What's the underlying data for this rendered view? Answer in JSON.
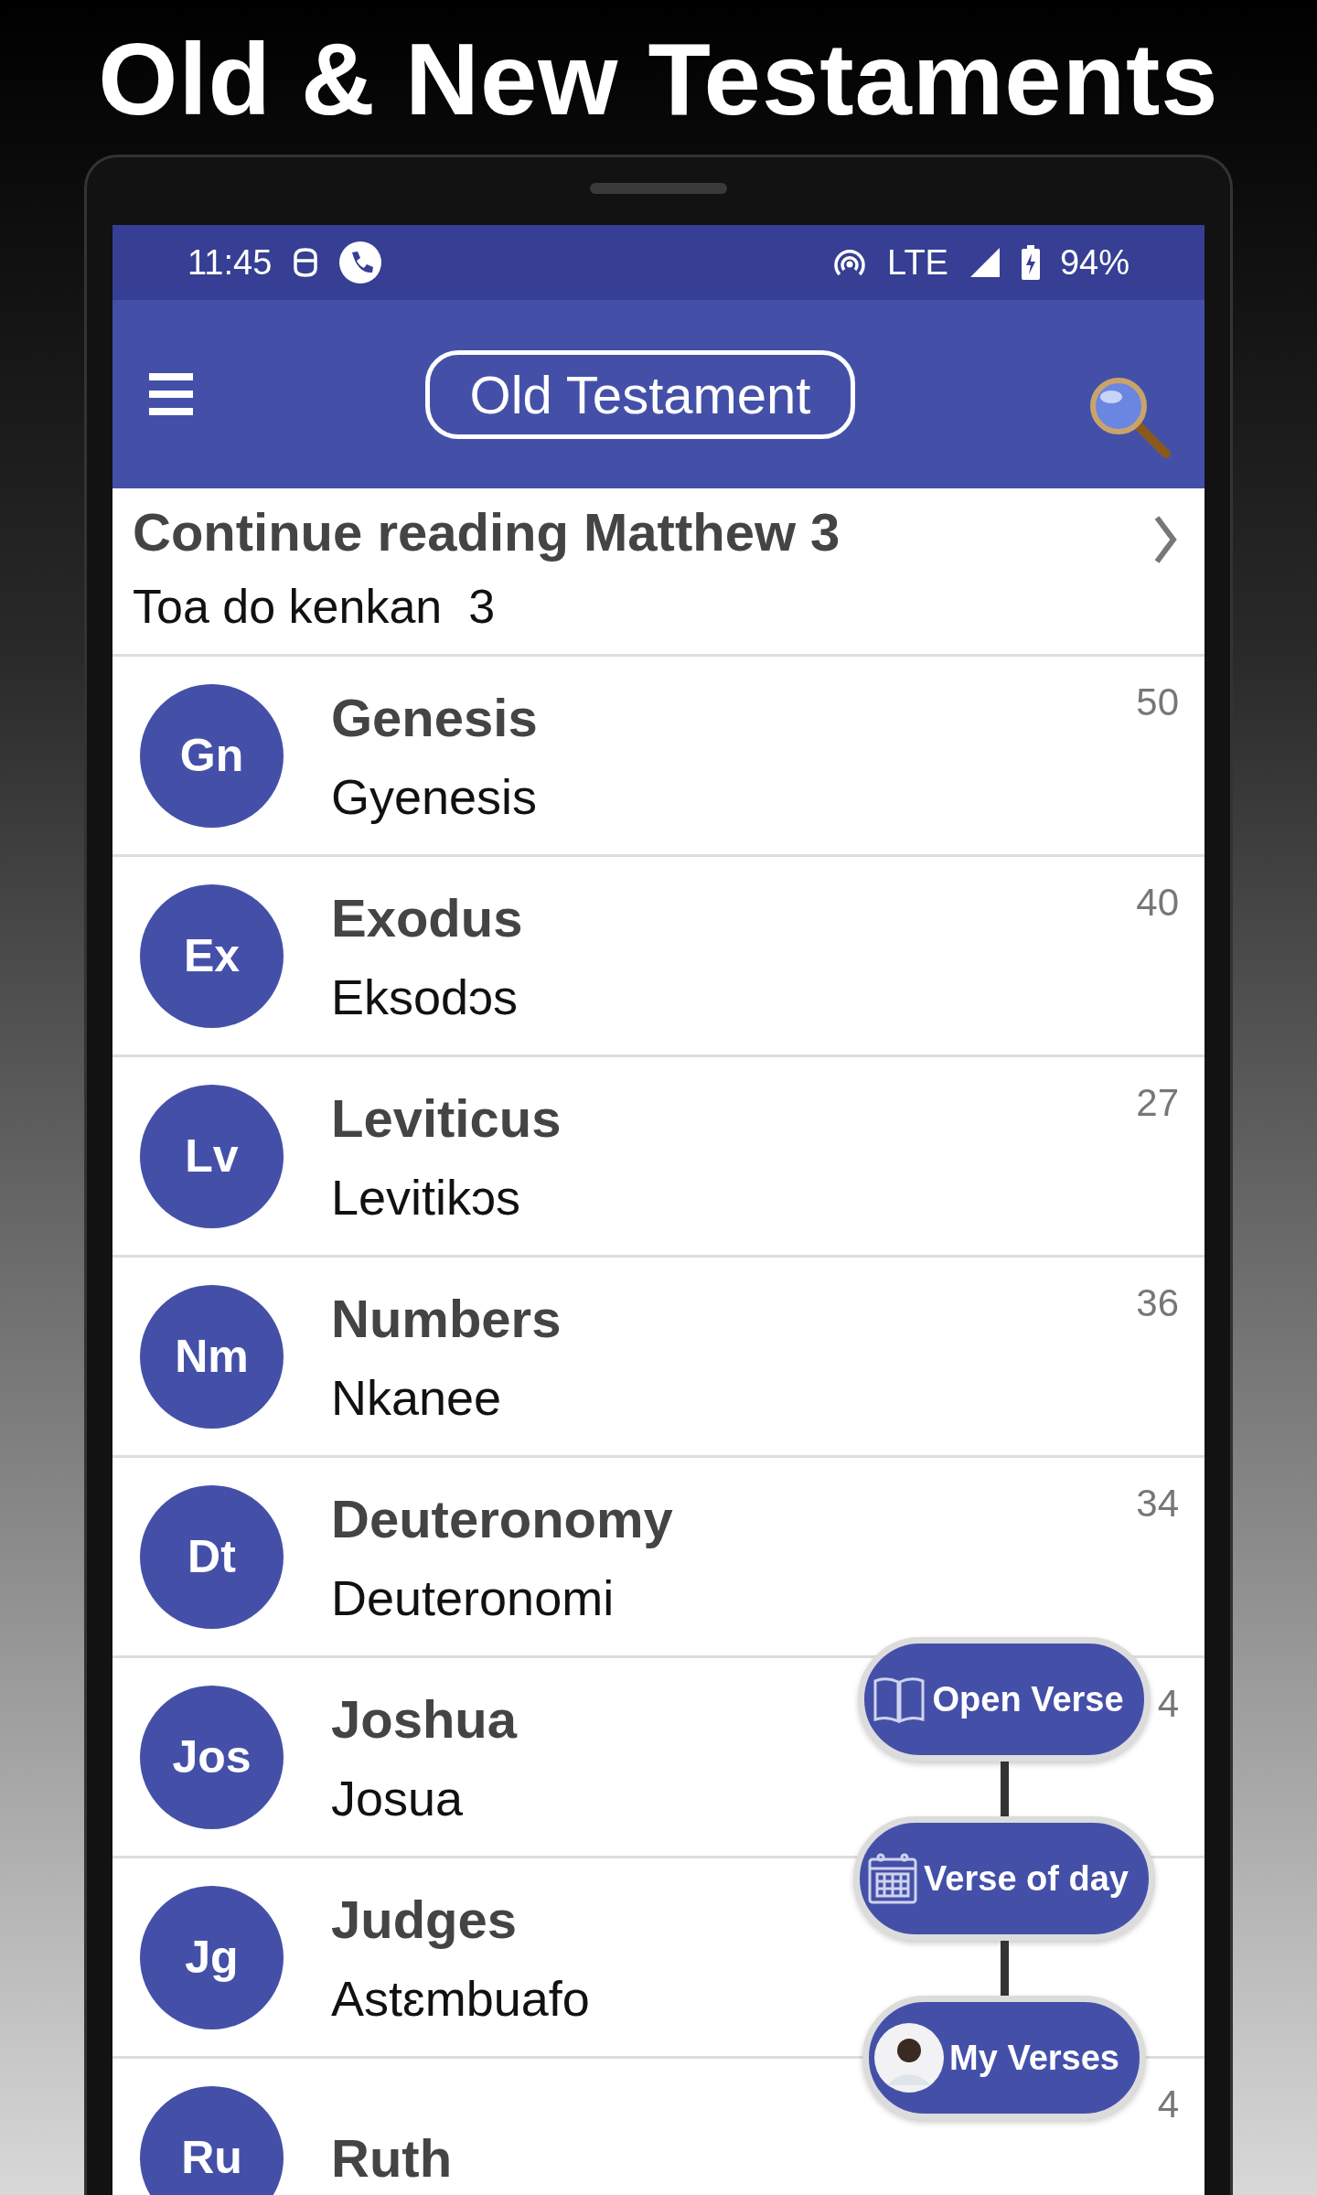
{
  "headline": "Old & New Testaments",
  "status_bar": {
    "time": "11:45",
    "network": "LTE",
    "battery": "94%"
  },
  "app_bar": {
    "title": "Old Testament"
  },
  "continue": {
    "title": "Continue reading Matthew 3",
    "subtitle": "Toa do kenkan  3"
  },
  "books": [
    {
      "abbr": "Gn",
      "name": "Genesis",
      "local_name": "Gyenesis",
      "chapters": "50"
    },
    {
      "abbr": "Ex",
      "name": "Exodus",
      "local_name": "Eksodɔs",
      "chapters": "40"
    },
    {
      "abbr": "Lv",
      "name": "Leviticus",
      "local_name": "Levitikɔs",
      "chapters": "27"
    },
    {
      "abbr": "Nm",
      "name": "Numbers",
      "local_name": "Nkanee",
      "chapters": "36"
    },
    {
      "abbr": "Dt",
      "name": "Deuteronomy",
      "local_name": "Deuteronomi",
      "chapters": "34"
    },
    {
      "abbr": "Jos",
      "name": "Joshua",
      "local_name": "Josua",
      "chapters": "4"
    },
    {
      "abbr": "Jg",
      "name": "Judges",
      "local_name": "Astɛmbuafo"
    },
    {
      "abbr": "Ru",
      "name": "Ruth",
      "chapters": "4"
    }
  ],
  "fab_menu": [
    {
      "label": "Open Verse",
      "kind": "book"
    },
    {
      "label": "Verse of day",
      "kind": "calendar"
    },
    {
      "label": "My Verses",
      "kind": "avatar"
    }
  ]
}
